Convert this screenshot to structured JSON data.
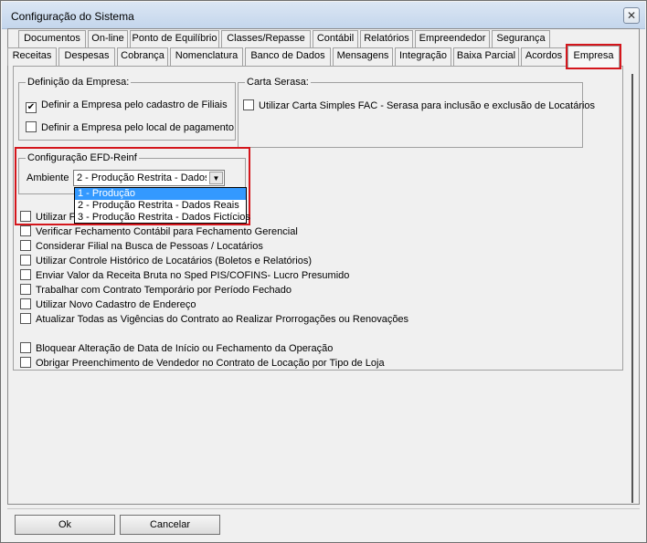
{
  "window": {
    "title": "Configuração do Sistema",
    "close_glyph": "✕"
  },
  "tabs_row1": [
    "Documentos",
    "On-line",
    "Ponto de Equilíbrio",
    "Classes/Repasse",
    "Contábil",
    "Relatórios",
    "Empreendedor",
    "Segurança"
  ],
  "tabs_row2": [
    "Receitas",
    "Despesas",
    "Cobrança",
    "Nomenclatura",
    "Banco de Dados",
    "Mensagens",
    "Integração",
    "Baixa Parcial",
    "Acordos",
    "Empresa"
  ],
  "active_tab": "Empresa",
  "definicao_empresa": {
    "label": "Definição da Empresa:",
    "opt1": {
      "label": "Definir a Empresa pelo cadastro de Filiais",
      "checked": true
    },
    "opt2": {
      "label": "Definir a Empresa pelo local de pagamento",
      "checked": false
    }
  },
  "carta_serasa": {
    "label": "Carta Serasa:",
    "opt1": {
      "label": "Utilizar Carta Simples FAC - Serasa para inclusão e exclusão de Locatários",
      "checked": false
    }
  },
  "efd_reinf": {
    "label": "Configuração EFD-Reinf",
    "ambiente_label": "Ambiente",
    "selected_value": "2 - Produção Restrita - Dados Reais",
    "options": [
      "1 - Produção",
      "2 - Produção Restrita - Dados Reais",
      "3 - Produção Restrita - Dados Fictícios"
    ],
    "highlighted_option": "1 - Produção"
  },
  "options": [
    {
      "label": "Utilizar Fe",
      "checked": false
    },
    {
      "label": "Verificar Fechamento Contábil para Fechamento Gerencial",
      "checked": false
    },
    {
      "label": "Considerar Filial na Busca de Pessoas / Locatários",
      "checked": false
    },
    {
      "label": "Utilizar Controle Histórico de Locatários (Boletos e Relatórios)",
      "checked": false
    },
    {
      "label": "Enviar Valor da Receita Bruta no Sped PIS/COFINS- Lucro Presumido",
      "checked": false
    },
    {
      "label": "Trabalhar com Contrato Temporário por Período Fechado",
      "checked": false
    },
    {
      "label": "Utilizar Novo Cadastro de Endereço",
      "checked": false
    },
    {
      "label": "Atualizar Todas as Vigências do Contrato ao Realizar Prorrogações ou Renovações",
      "checked": false
    },
    {
      "label": "Bloquear Alteração de Data de Início ou Fechamento da Operação",
      "checked": false
    },
    {
      "label": "Obrigar Preenchimento de Vendedor no Contrato de Locação por Tipo de Loja",
      "checked": false
    }
  ],
  "buttons": {
    "ok": "Ok",
    "cancel": "Cancelar"
  },
  "colors": {
    "highlight_red": "#d4161c",
    "selection_blue": "#3399ff"
  }
}
